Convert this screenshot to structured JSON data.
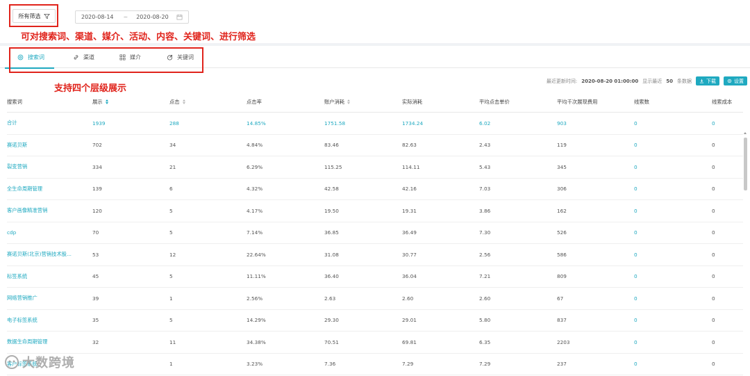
{
  "filter": {
    "label": "所有筛选",
    "icon": "filter-icon"
  },
  "date_range": {
    "start": "2020-08-14",
    "separator": "~",
    "end": "2020-08-20",
    "icon": "calendar-icon"
  },
  "annotations": {
    "filter_note": "可对搜索词、渠道、媒介、活动、内容、关键词、进行筛选",
    "tabs_note": "支持四个层级展示",
    "color": "#e0231b"
  },
  "tabs": [
    {
      "label": "搜索词",
      "icon": "target-icon",
      "active": true
    },
    {
      "label": "渠道",
      "icon": "link-icon",
      "active": false
    },
    {
      "label": "媒介",
      "icon": "grid-icon",
      "active": false
    },
    {
      "label": "关键词",
      "icon": "keyword-icon",
      "active": false
    }
  ],
  "meta": {
    "updated_label": "最近更新时间:",
    "updated_value": "2020-08-20 01:00:00",
    "show_prefix": "显示最近",
    "show_count": "50",
    "show_suffix": "条数据",
    "download_label": "下载",
    "settings_label": "设置"
  },
  "table": {
    "headers": [
      "搜索词",
      "展示",
      "点击",
      "点击率",
      "账户消耗",
      "实际消耗",
      "平均点击单价",
      "平均千次展现费用",
      "线索数",
      "线索成本"
    ],
    "sortable": [
      false,
      true,
      true,
      false,
      true,
      false,
      false,
      false,
      false,
      false
    ],
    "sorted_column": 1,
    "total": [
      "合计",
      "1939",
      "288",
      "14.85%",
      "1751.58",
      "1734.24",
      "6.02",
      "903",
      "0",
      "0"
    ],
    "rows": [
      [
        "赛诺贝斯",
        "702",
        "34",
        "4.84%",
        "83.46",
        "82.63",
        "2.43",
        "119",
        "0",
        "0"
      ],
      [
        "裂变营销",
        "334",
        "21",
        "6.29%",
        "115.25",
        "114.11",
        "5.43",
        "345",
        "0",
        "0"
      ],
      [
        "全生命周期管理",
        "139",
        "6",
        "4.32%",
        "42.58",
        "42.16",
        "7.03",
        "306",
        "0",
        "0"
      ],
      [
        "客户画像精准营销",
        "120",
        "5",
        "4.17%",
        "19.50",
        "19.31",
        "3.86",
        "162",
        "0",
        "0"
      ],
      [
        "cdp",
        "70",
        "5",
        "7.14%",
        "36.85",
        "36.49",
        "7.30",
        "526",
        "0",
        "0"
      ],
      [
        "赛诺贝斯(北京)营销技术股...",
        "53",
        "12",
        "22.64%",
        "31.08",
        "30.77",
        "2.56",
        "586",
        "0",
        "0"
      ],
      [
        "标签系统",
        "45",
        "5",
        "11.11%",
        "36.40",
        "36.04",
        "7.21",
        "809",
        "0",
        "0"
      ],
      [
        "网络营销推广",
        "39",
        "1",
        "2.56%",
        "2.63",
        "2.60",
        "2.60",
        "67",
        "0",
        "0"
      ],
      [
        "电子标签系统",
        "35",
        "5",
        "14.29%",
        "29.30",
        "29.01",
        "5.80",
        "837",
        "0",
        "0"
      ],
      [
        "数据生命周期管理",
        "32",
        "11",
        "34.38%",
        "70.51",
        "69.81",
        "6.35",
        "2203",
        "0",
        "0"
      ],
      [
        "客户标签系统",
        "",
        "1",
        "3.23%",
        "7.36",
        "7.29",
        "7.29",
        "237",
        "0",
        "0"
      ]
    ]
  },
  "watermark": "大数跨境",
  "accent": "#1fa9c0"
}
